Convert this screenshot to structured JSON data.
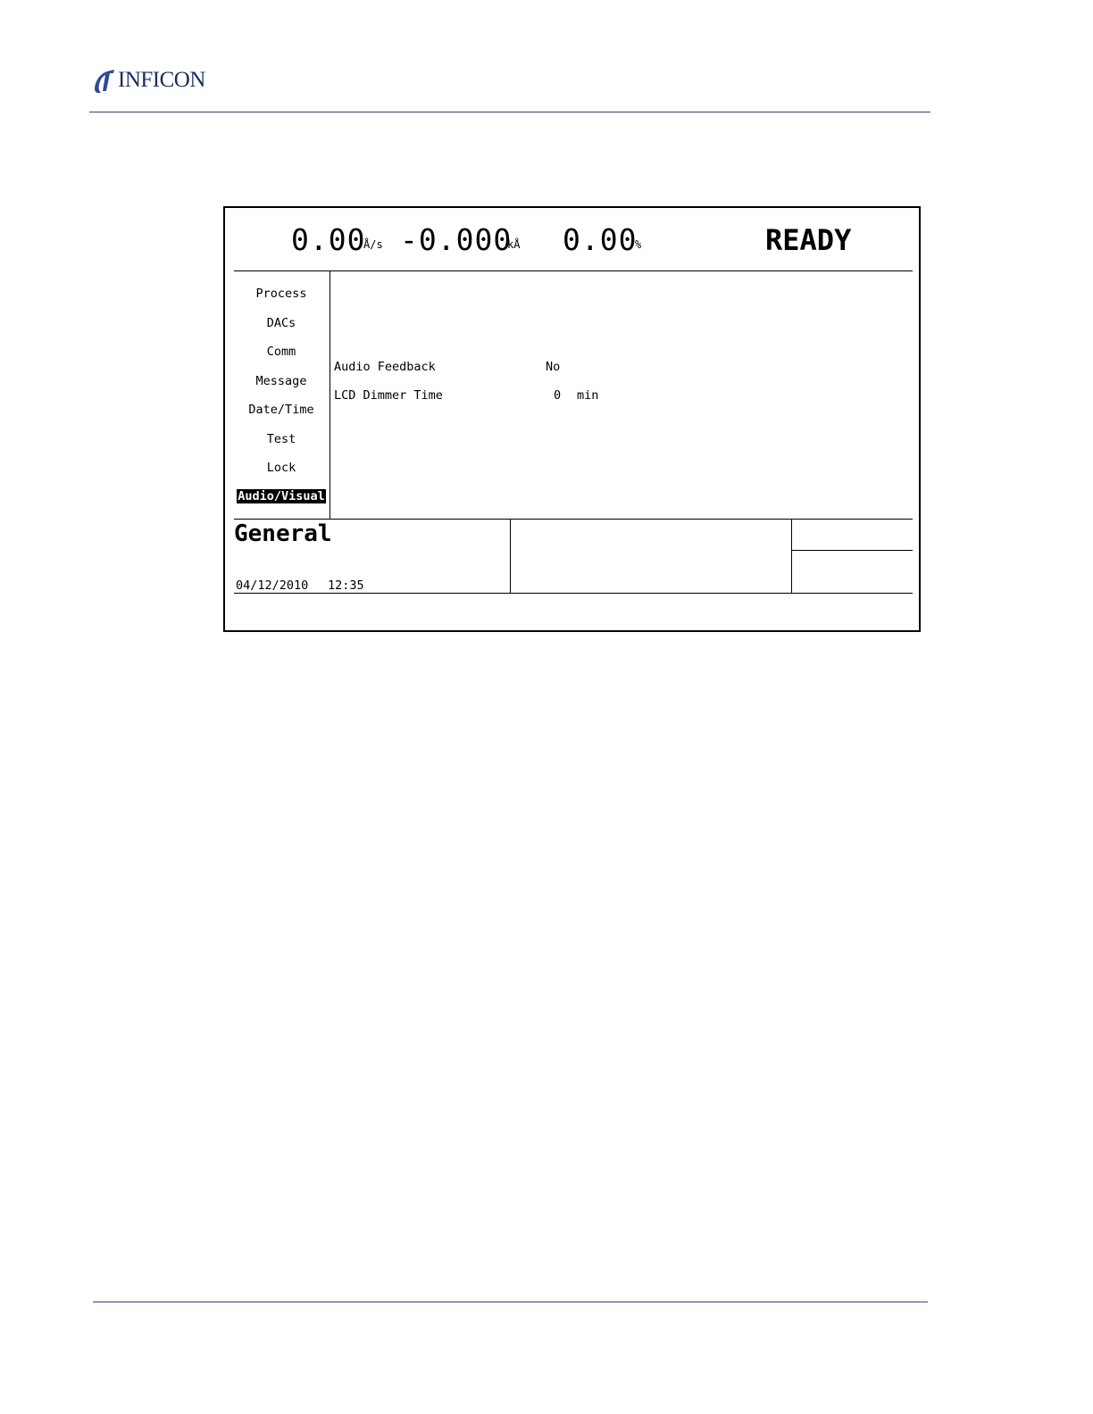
{
  "brand": {
    "name": "INFICON"
  },
  "readout": {
    "rate_value": "0.00",
    "rate_unit": "Å/s",
    "thickness_value": "-0.000",
    "thickness_unit": "kÅ",
    "power_value": "0.00",
    "power_unit": "%",
    "status": "READY"
  },
  "menu": {
    "items": [
      {
        "label": "Process"
      },
      {
        "label": "DACs"
      },
      {
        "label": "Comm"
      },
      {
        "label": "Message"
      },
      {
        "label": "Date/Time"
      },
      {
        "label": "Test"
      },
      {
        "label": "Lock"
      },
      {
        "label": "Audio/Visual",
        "selected": true
      }
    ]
  },
  "params": {
    "audio_feedback": {
      "label": "Audio Feedback",
      "value": "No"
    },
    "lcd_dimmer_time": {
      "label": "LCD Dimmer Time",
      "value": "0",
      "unit": "min"
    }
  },
  "footer": {
    "title": "General",
    "date": "04/12/2010",
    "time": "12:35"
  }
}
